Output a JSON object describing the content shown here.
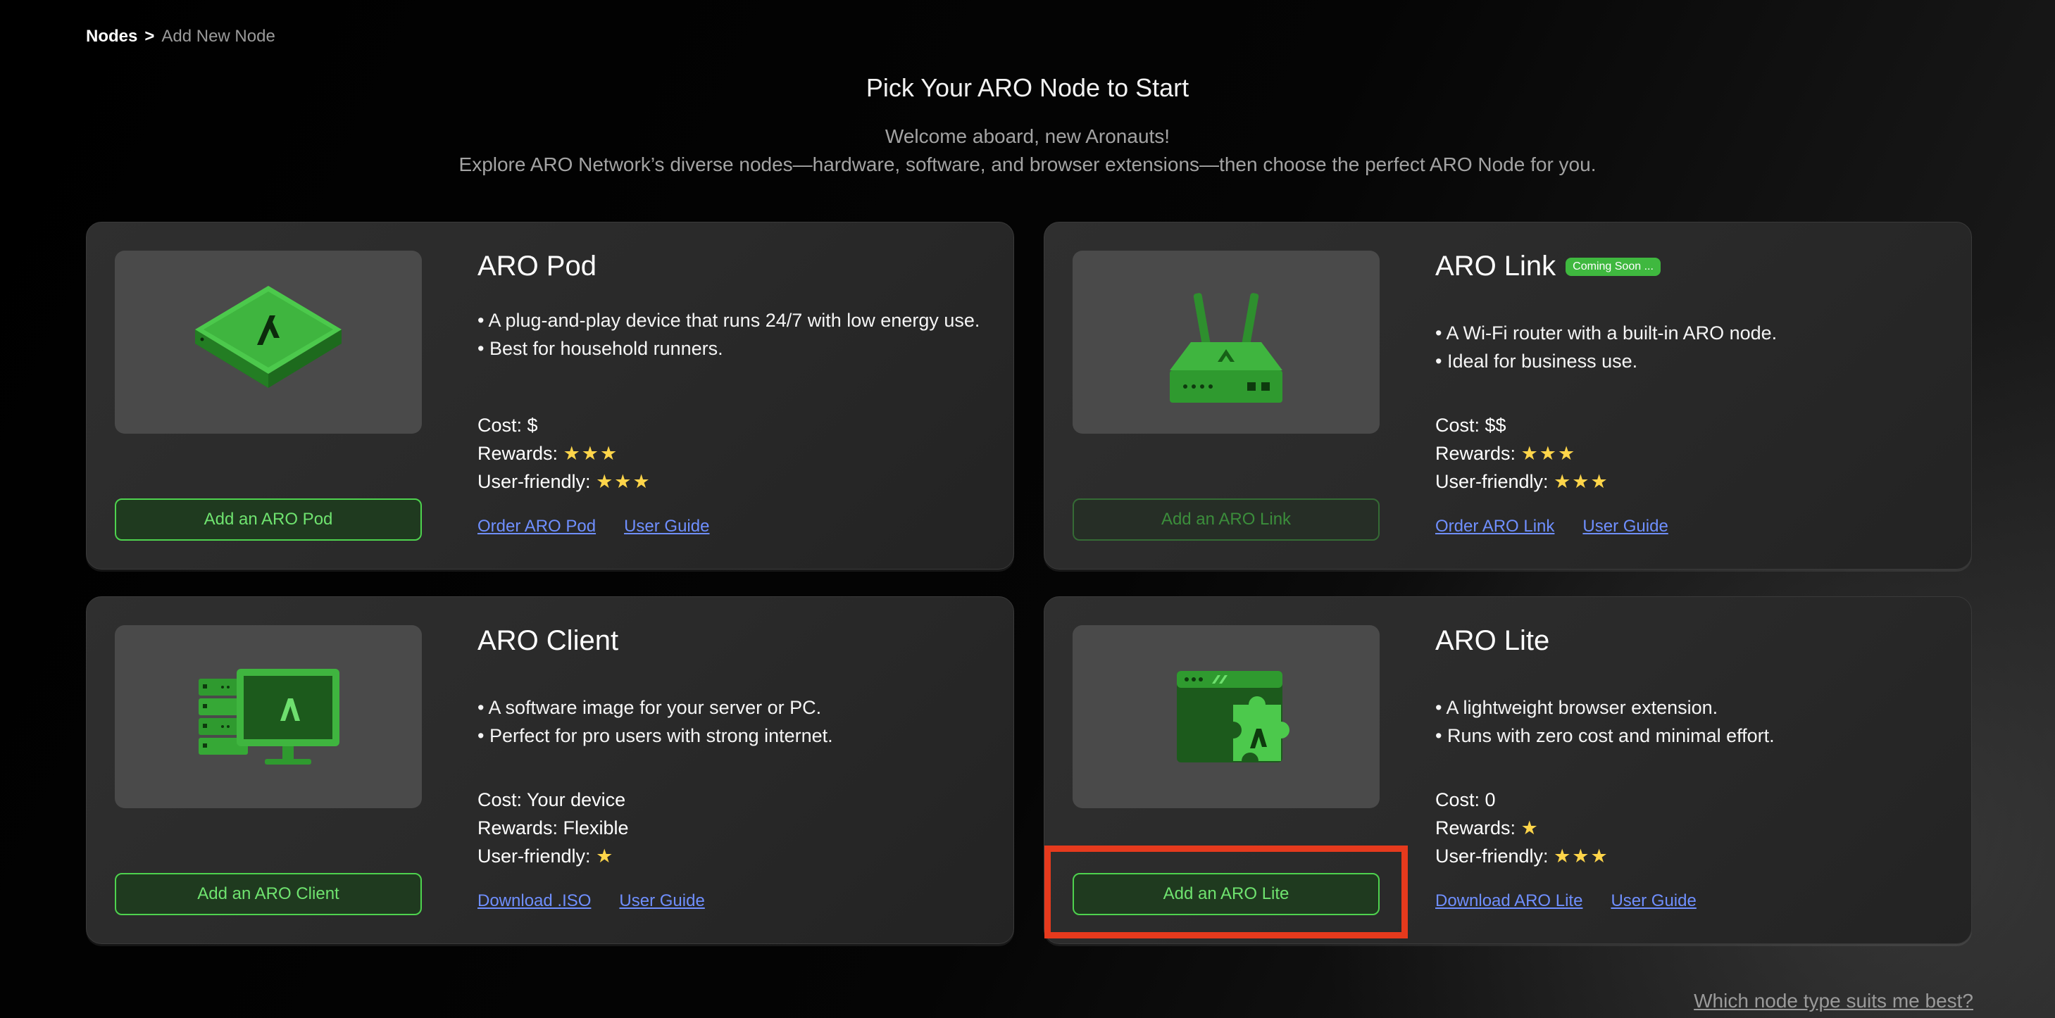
{
  "breadcrumb": {
    "root": "Nodes",
    "separator": ">",
    "current": "Add New Node"
  },
  "page": {
    "title": "Pick Your ARO Node to Start",
    "subtitle_line1": "Welcome aboard, new Aronauts!",
    "subtitle_line2": "Explore ARO Network’s diverse nodes—hardware, software, and browser extensions—then choose the perfect ARO Node for you."
  },
  "colors": {
    "accent_green": "#4ed24e",
    "link_blue": "#6f8fff",
    "highlight_red": "#e63a1d"
  },
  "cards": [
    {
      "title": "ARO Pod",
      "icon": "aro-pod-device-icon",
      "bullets": [
        "• A plug-and-play device that runs 24/7 with low energy use.",
        "• Best for household runners."
      ],
      "cost": "Cost: $",
      "rewards_label": "Rewards:",
      "rewards_stars": "★★★",
      "friendly_label": "User-friendly:",
      "friendly_stars": "★★★",
      "button": "Add an ARO Pod",
      "link1": "Order ARO Pod",
      "link2": "User Guide"
    },
    {
      "title": "ARO Link",
      "badge": "Coming Soon ...",
      "icon": "router-icon",
      "bullets": [
        "• A Wi-Fi router with a built-in ARO node.",
        "• Ideal for business use."
      ],
      "cost": "Cost: $$",
      "rewards_label": "Rewards:",
      "rewards_stars": "★★★",
      "friendly_label": "User-friendly:",
      "friendly_stars": "★★★",
      "button": "Add an ARO Link",
      "link1": "Order ARO Link",
      "link2": "User Guide"
    },
    {
      "title": "ARO Client",
      "icon": "server-monitor-icon",
      "bullets": [
        "• A software image for your server or PC.",
        "• Perfect for pro users with strong internet."
      ],
      "cost": "Cost: Your device",
      "rewards_label": "Rewards: Flexible",
      "rewards_stars": "",
      "friendly_label": "User-friendly:",
      "friendly_stars": "★",
      "button": "Add an ARO Client",
      "link1": "Download .ISO",
      "link2": "User Guide"
    },
    {
      "title": "ARO Lite",
      "icon": "browser-extension-icon",
      "bullets": [
        "• A lightweight browser extension.",
        "• Runs with zero cost and minimal effort."
      ],
      "cost": "Cost: 0",
      "rewards_label": "Rewards:",
      "rewards_stars": "★",
      "friendly_label": "User-friendly:",
      "friendly_stars": "★★★",
      "button": "Add an ARO Lite",
      "link1": "Download ARO Lite",
      "link2": "User Guide"
    }
  ],
  "footer": {
    "help_link": "Which node type suits me best?"
  }
}
